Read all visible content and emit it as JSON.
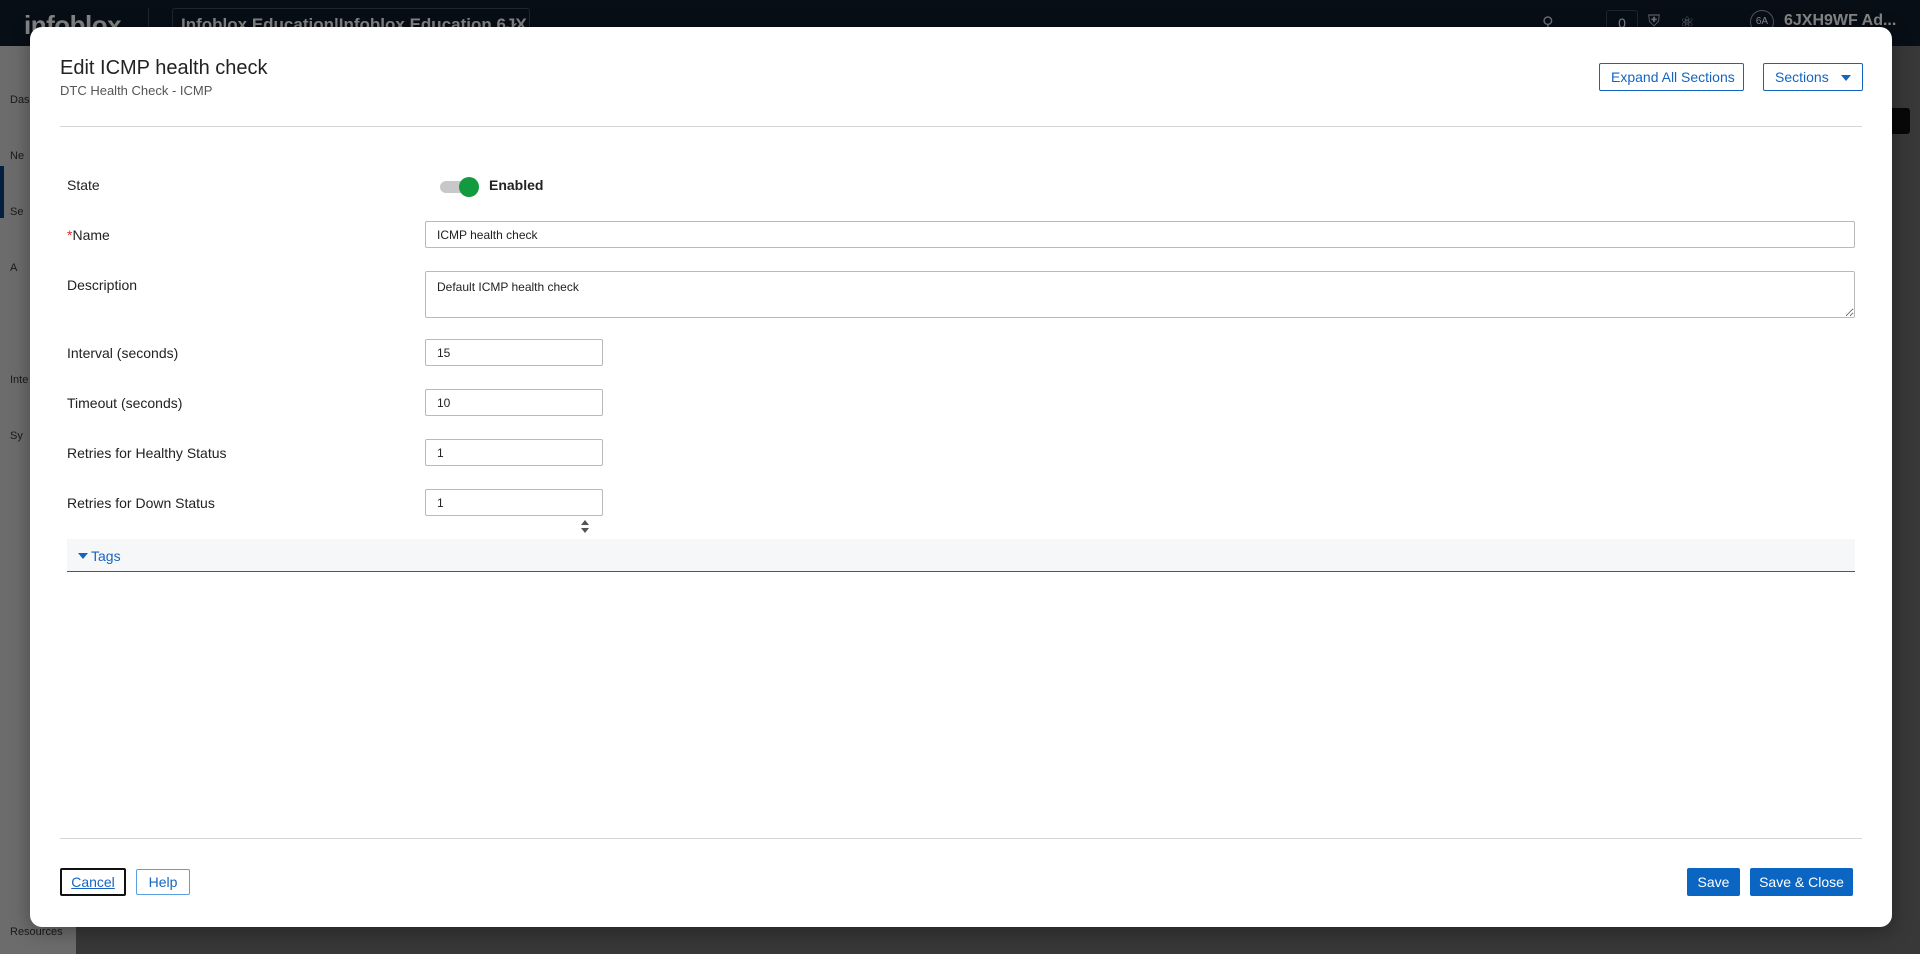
{
  "background": {
    "logo": "infoblox",
    "org_selector": "Infoblox Education|Infoblox Education 6JX",
    "notification_count": "0",
    "avatar_initials": "6A",
    "user_label": "6JXH9WF Ad...",
    "sidebar_labels": [
      "Das",
      "Ne",
      "Se",
      "A",
      "Inte",
      "Sy",
      "Resources"
    ]
  },
  "modal": {
    "title": "Edit ICMP health check",
    "subtitle": "DTC Health Check - ICMP",
    "expand_all_label": "Expand All Sections",
    "sections_label": "Sections"
  },
  "form": {
    "state": {
      "label": "State",
      "value": "Enabled"
    },
    "name": {
      "label": "Name",
      "required_mark": "*",
      "value": "ICMP health check"
    },
    "description": {
      "label": "Description",
      "value": "Default ICMP health check"
    },
    "interval": {
      "label": "Interval (seconds)",
      "value": "15"
    },
    "timeout": {
      "label": "Timeout (seconds)",
      "value": "10"
    },
    "retries_healthy": {
      "label": "Retries for Healthy Status",
      "value": "1"
    },
    "retries_down": {
      "label": "Retries for Down Status",
      "value": "1"
    }
  },
  "tags_section": {
    "label": "Tags"
  },
  "footer": {
    "cancel_label": "Cancel",
    "help_label": "Help",
    "save_label": "Save",
    "save_close_label": "Save & Close"
  },
  "colors": {
    "accent": "#1565c0",
    "toggle_on": "#119b3e",
    "primary_button": "#0a66c2",
    "required": "#d32f2f"
  }
}
